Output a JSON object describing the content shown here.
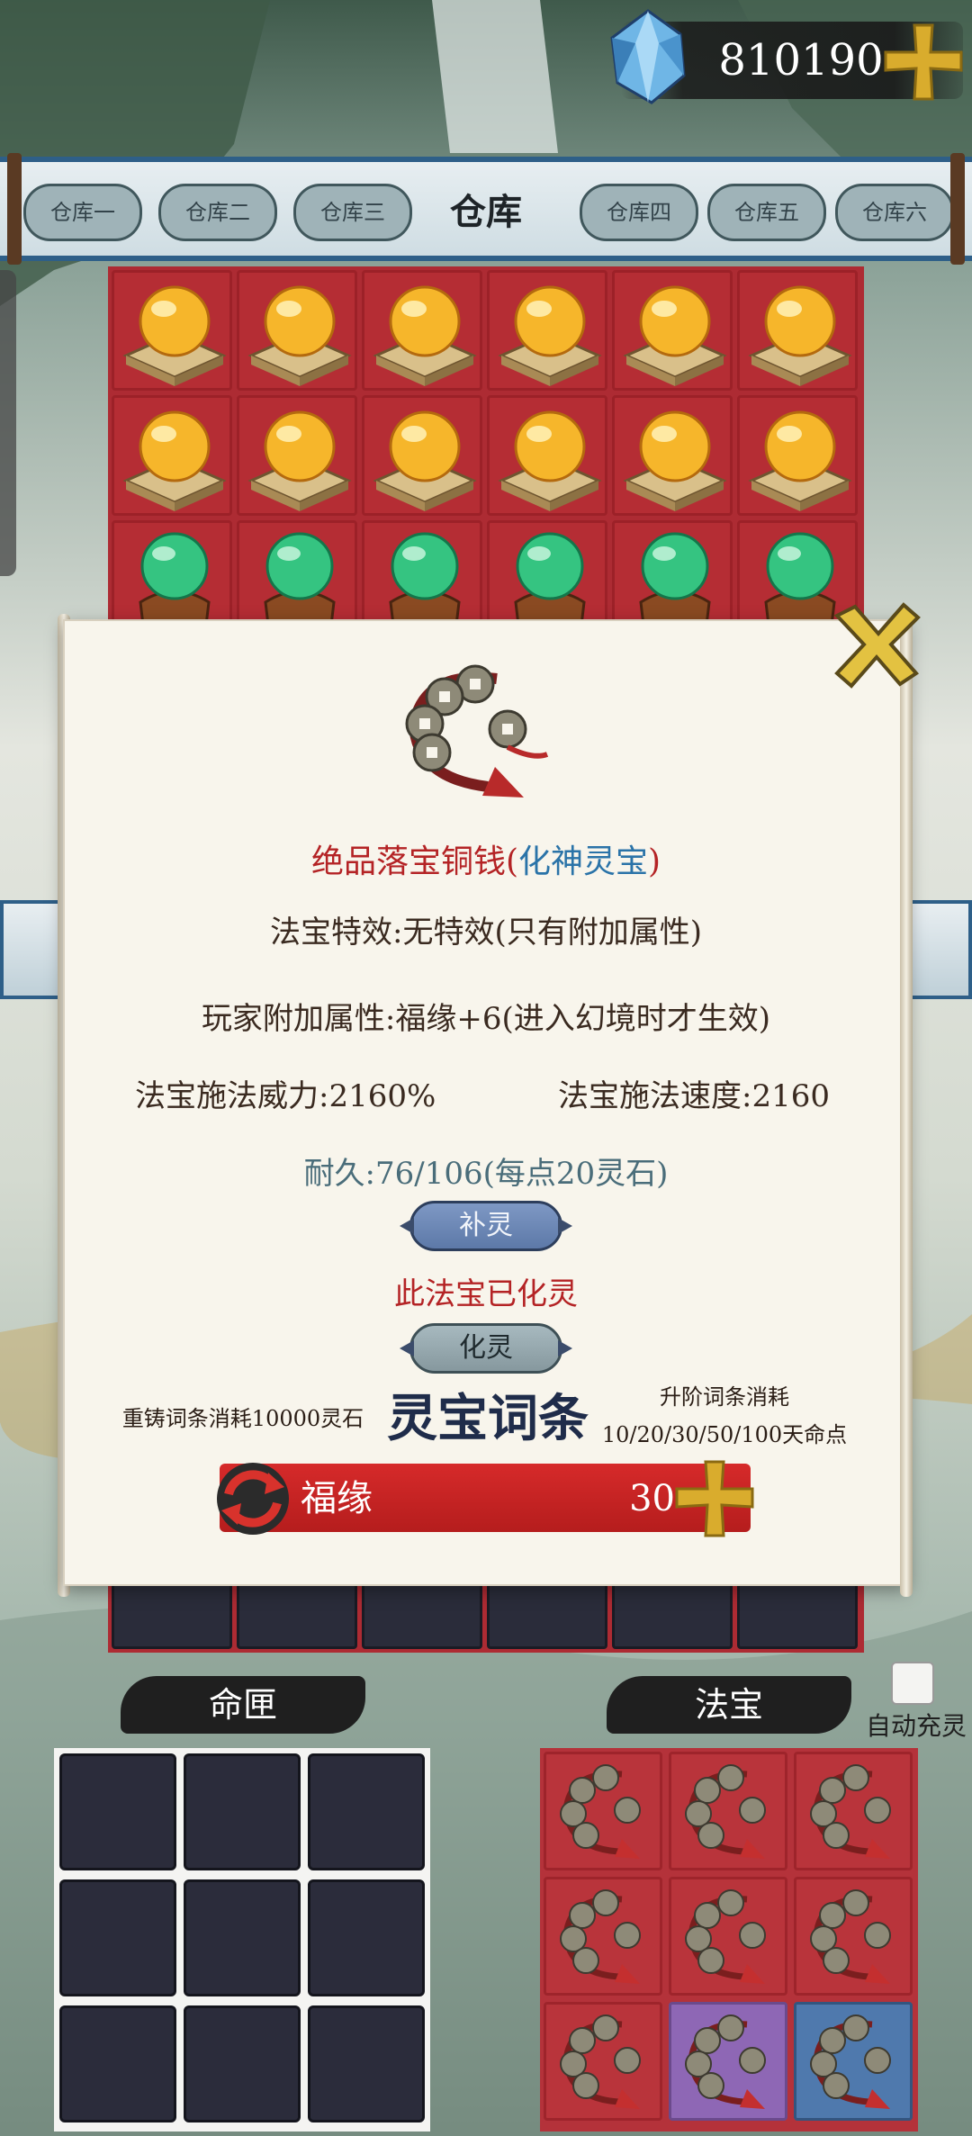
{
  "currency": {
    "value": "810190",
    "icon": "spirit-stone-gem-icon"
  },
  "warehouse": {
    "title": "仓库",
    "tabs": [
      "仓库一",
      "仓库二",
      "仓库三",
      "仓库四",
      "仓库五",
      "仓库六"
    ]
  },
  "dialog": {
    "item_name_prefix": "绝品落宝铜钱",
    "item_name_open": "(",
    "item_name_tier": "化神灵宝",
    "item_name_close": ")",
    "effect": "法宝特效:无特效(只有附加属性)",
    "player_attr": "玩家附加属性:福缘+6(进入幻境时才生效)",
    "power": "法宝施法威力:2160%",
    "speed": "法宝施法速度:2160",
    "durability": "耐久:76/106(每点20灵石)",
    "replenish_label": "补灵",
    "status": "此法宝已化灵",
    "transform_label": "化灵",
    "reforge_cost": "重铸词条消耗10000灵石",
    "affix_title": "灵宝词条",
    "upgrade_cost_line1": "升阶词条消耗",
    "upgrade_cost_line2": "10/20/30/50/100天命点",
    "affix": {
      "name": "福缘",
      "value": "30"
    }
  },
  "sections": {
    "fate_label": "命匣",
    "treasure_label": "法宝",
    "auto_recharge_label": "自动充灵"
  },
  "colors": {
    "warehouse_bg": "#ad2b33",
    "affix_bar": "#c82222",
    "tier_blue": "#2a73a8",
    "name_red": "#b42325"
  }
}
